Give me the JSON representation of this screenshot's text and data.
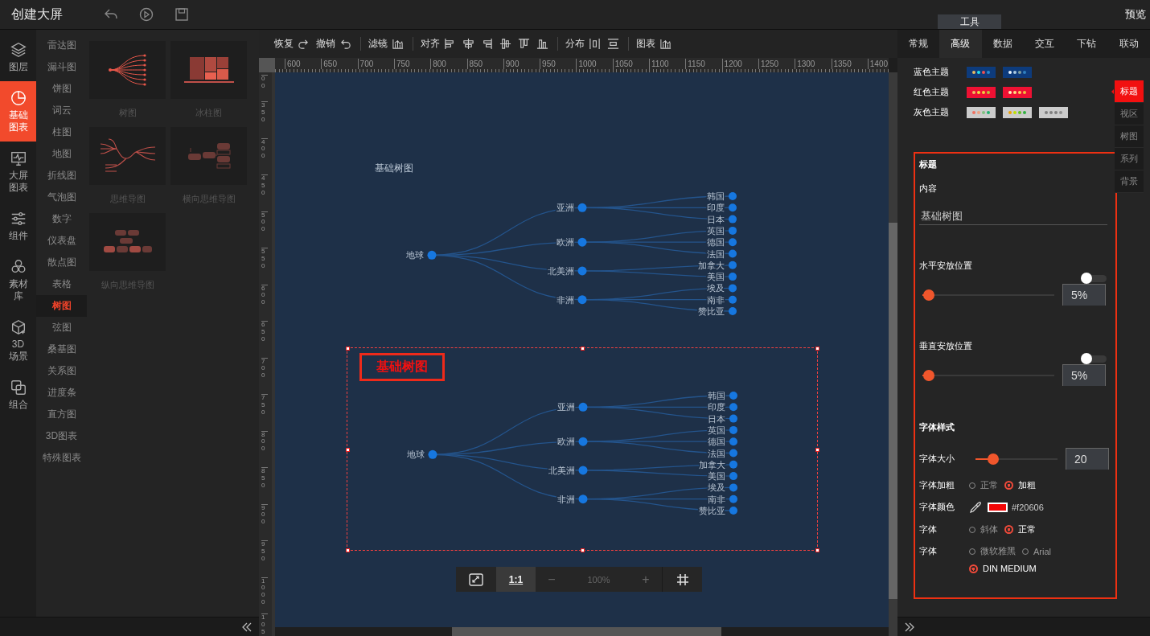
{
  "app": {
    "title": "创建大屏"
  },
  "top_bar": {
    "tool_tab": "工具",
    "preview": "预览"
  },
  "nav": [
    {
      "label": "图层",
      "kind": "layers",
      "selected": false
    },
    {
      "label": "基础图表",
      "kind": "pie",
      "selected": true
    },
    {
      "label": "大屏图表",
      "kind": "monitor",
      "selected": false
    },
    {
      "label": "组件",
      "kind": "sliders",
      "selected": false
    },
    {
      "label": "素材库",
      "kind": "hexagons",
      "selected": false
    },
    {
      "label": "3D场景",
      "kind": "cube",
      "selected": false
    },
    {
      "label": "组合",
      "kind": "combine",
      "selected": false
    }
  ],
  "chart_types": [
    {
      "label": "雷达图",
      "selected": false
    },
    {
      "label": "漏斗图",
      "selected": false
    },
    {
      "label": "饼图",
      "selected": false
    },
    {
      "label": "词云",
      "selected": false
    },
    {
      "label": "柱图",
      "selected": false
    },
    {
      "label": "地图",
      "selected": false
    },
    {
      "label": "折线图",
      "selected": false
    },
    {
      "label": "气泡图",
      "selected": false
    },
    {
      "label": "数字",
      "selected": false
    },
    {
      "label": "仪表盘",
      "selected": false
    },
    {
      "label": "散点图",
      "selected": false
    },
    {
      "label": "表格",
      "selected": false
    },
    {
      "label": "树图",
      "selected": true
    },
    {
      "label": "弦图",
      "selected": false
    },
    {
      "label": "桑基图",
      "selected": false
    },
    {
      "label": "关系图",
      "selected": false
    },
    {
      "label": "进度条",
      "selected": false
    },
    {
      "label": "直方图",
      "selected": false
    },
    {
      "label": "3D图表",
      "selected": false
    },
    {
      "label": "特殊图表",
      "selected": false
    }
  ],
  "templates": [
    {
      "label": "树图",
      "kind": "tree"
    },
    {
      "label": "冰柱图",
      "kind": "icicle"
    },
    {
      "label": "思维导图",
      "kind": "mindmap"
    },
    {
      "label": "横向思维导图",
      "kind": "hmindmap"
    },
    {
      "label": "纵向思维导图",
      "kind": "vmindmap"
    }
  ],
  "toolbar": [
    {
      "label": "恢复",
      "kind": "redo",
      "divider": false
    },
    {
      "label": "撤销",
      "kind": "undo",
      "divider": false
    },
    {
      "label": "滤镜",
      "kind": "filter",
      "divider": true
    },
    {
      "label": "对齐",
      "kind": "align",
      "divider": true
    },
    {
      "label": "分布",
      "kind": "distribute",
      "divider": true
    },
    {
      "label": "图表",
      "kind": "chart",
      "divider": true
    }
  ],
  "ruler": {
    "x_labels": [
      "600",
      "650",
      "700",
      "750",
      "800",
      "850",
      "900",
      "950",
      "1000",
      "1050",
      "1100",
      "1150",
      "1200",
      "1250",
      "1300",
      "1350",
      "1400"
    ],
    "y_labels": [
      "00",
      "350",
      "400",
      "450",
      "500",
      "550",
      "600",
      "650",
      "700",
      "750",
      "800",
      "850",
      "900",
      "950",
      "1000",
      "105"
    ]
  },
  "charts": [
    {
      "title": "基础树图",
      "selected": false,
      "root": {
        "name": "地球",
        "children": [
          {
            "name": "亚洲",
            "children": [
              {
                "name": "韩国"
              },
              {
                "name": "印度"
              },
              {
                "name": "日本"
              }
            ]
          },
          {
            "name": "欧洲",
            "children": [
              {
                "name": "英国"
              },
              {
                "name": "德国"
              },
              {
                "name": "法国"
              }
            ]
          },
          {
            "name": "北美洲",
            "children": [
              {
                "name": "加拿大"
              },
              {
                "name": "美国"
              }
            ]
          },
          {
            "name": "非洲",
            "children": [
              {
                "name": "埃及"
              },
              {
                "name": "南非"
              },
              {
                "name": "赞比亚"
              }
            ]
          }
        ]
      }
    },
    {
      "title": "基础树图",
      "selected": true,
      "root": {
        "name": "地球",
        "children": [
          {
            "name": "亚洲",
            "children": [
              {
                "name": "韩国"
              },
              {
                "name": "印度"
              },
              {
                "name": "日本"
              }
            ]
          },
          {
            "name": "欧洲",
            "children": [
              {
                "name": "英国"
              },
              {
                "name": "德国"
              },
              {
                "name": "法国"
              }
            ]
          },
          {
            "name": "北美洲",
            "children": [
              {
                "name": "加拿大"
              },
              {
                "name": "美国"
              }
            ]
          },
          {
            "name": "非洲",
            "children": [
              {
                "name": "埃及"
              },
              {
                "name": "南非"
              },
              {
                "name": "赞比亚"
              }
            ]
          }
        ]
      }
    }
  ],
  "zoom_bar": {
    "ratio": "1:1",
    "minus": "−",
    "zoom": "100%",
    "plus": "+"
  },
  "panel": {
    "tabs": [
      {
        "label": "常规",
        "selected": false
      },
      {
        "label": "高级",
        "selected": true
      },
      {
        "label": "数据",
        "selected": false
      },
      {
        "label": "交互",
        "selected": false
      },
      {
        "label": "下钻",
        "selected": false
      },
      {
        "label": "联动",
        "selected": false
      }
    ],
    "themes": [
      {
        "label": "蓝色主题",
        "swatches": [
          {
            "color": "#0d3b7c",
            "dots": [
              {
                "color": "#e8b860"
              },
              {
                "color": "#22e0f0"
              },
              {
                "color": "#f05050"
              },
              {
                "color": "#2a8ad0"
              }
            ]
          },
          {
            "color": "#0d3b7c",
            "dots": [
              {
                "color": "#e8f4ff"
              },
              {
                "color": "#a8c8e0"
              },
              {
                "color": "#80a0a0"
              },
              {
                "color": "#3080c0"
              }
            ]
          }
        ]
      },
      {
        "label": "红色主题",
        "swatches": [
          {
            "color": "#ee1133",
            "dots": [
              {
                "color": "#f0c060"
              },
              {
                "color": "#f0e040"
              },
              {
                "color": "#f0d040"
              },
              {
                "color": "#c0c040"
              }
            ]
          },
          {
            "color": "#ee1133",
            "dots": [
              {
                "color": "#fff0c0"
              },
              {
                "color": "#ffe080"
              },
              {
                "color": "#ffd060"
              },
              {
                "color": "#f0c040"
              }
            ]
          }
        ]
      },
      {
        "label": "灰色主题",
        "swatches": [
          {
            "color": "#cccccc",
            "dots": [
              {
                "color": "#f07060"
              },
              {
                "color": "#f0a080"
              },
              {
                "color": "#80c080"
              },
              {
                "color": "#20b070"
              }
            ]
          },
          {
            "color": "#cccccc",
            "dots": [
              {
                "color": "#f0a000"
              },
              {
                "color": "#c0e000"
              },
              {
                "color": "#60c020"
              },
              {
                "color": "#30b040"
              }
            ]
          },
          {
            "color": "#cccccc",
            "dots": [
              {
                "color": "#808080"
              },
              {
                "color": "#808080"
              },
              {
                "color": "#808080"
              },
              {
                "color": "#909090"
              }
            ]
          }
        ]
      }
    ],
    "side_tabs": [
      {
        "label": "标题",
        "selected": true
      },
      {
        "label": "视区",
        "selected": false
      },
      {
        "label": "树图",
        "selected": false
      },
      {
        "label": "系列",
        "selected": false
      },
      {
        "label": "背景",
        "selected": false
      }
    ],
    "form": {
      "section": "标题",
      "content_label": "内容",
      "content_value": "基础树图",
      "positions": [
        {
          "label": "水平安放位置",
          "toggle_on": false,
          "level": 0.05,
          "value": "5%"
        },
        {
          "label": "垂直安放位置",
          "toggle_on": false,
          "level": 0.05,
          "value": "5%"
        }
      ],
      "font_section": "字体样式",
      "font_size": {
        "label": "字体大小",
        "level": 0.22,
        "value": "20"
      },
      "rows": [
        {
          "label": "字体加粗",
          "kind": "radio",
          "options": [
            {
              "label": "正常",
              "selected": false
            },
            {
              "label": "加粗",
              "selected": true
            }
          ]
        },
        {
          "label": "字体颜色",
          "kind": "color",
          "color": "#f20606",
          "value": "#f20606"
        },
        {
          "label": "字体",
          "kind": "radio",
          "options": [
            {
              "label": "斜体",
              "selected": false
            },
            {
              "label": "正常",
              "selected": true
            }
          ]
        },
        {
          "label": "字体",
          "kind": "radio",
          "options": [
            {
              "label": "微软雅黑",
              "selected": false
            },
            {
              "label": "Arial",
              "selected": false
            },
            {
              "label": "DIN MEDIUM",
              "selected": true
            }
          ]
        }
      ]
    }
  }
}
